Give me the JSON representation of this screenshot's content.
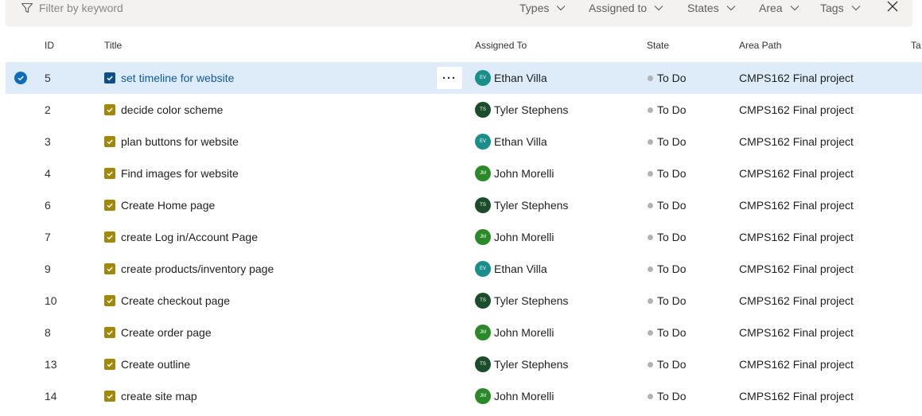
{
  "filter": {
    "placeholder": "Filter by keyword",
    "pills": [
      "Types",
      "Assigned to",
      "States",
      "Area",
      "Tags"
    ]
  },
  "columns": {
    "id": "ID",
    "title": "Title",
    "assigned": "Assigned To",
    "state": "State",
    "area": "Area Path",
    "tags": "Ta"
  },
  "colors": {
    "ethan": "#1a8f8a",
    "tyler": "#1b4d2b",
    "john": "#2a8a2a",
    "task_icon": "#a4880a",
    "selected_bg": "#deecf9",
    "accent": "#0f6cbd"
  },
  "rows": [
    {
      "id": "5",
      "title": "set timeline for website",
      "initials": "EV",
      "assigned": "Ethan Villa",
      "state": "To Do",
      "area": "CMPS162 Final project"
    },
    {
      "id": "2",
      "title": "decide color scheme",
      "initials": "TS",
      "assigned": "Tyler Stephens",
      "state": "To Do",
      "area": "CMPS162 Final project"
    },
    {
      "id": "3",
      "title": "plan buttons for website",
      "initials": "EV",
      "assigned": "Ethan Villa",
      "state": "To Do",
      "area": "CMPS162 Final project"
    },
    {
      "id": "4",
      "title": "Find images for website",
      "initials": "JM",
      "assigned": "John Morelli",
      "state": "To Do",
      "area": "CMPS162 Final project"
    },
    {
      "id": "6",
      "title": "Create Home page",
      "initials": "TS",
      "assigned": "Tyler Stephens",
      "state": "To Do",
      "area": "CMPS162 Final project"
    },
    {
      "id": "7",
      "title": "create Log in/Account Page",
      "initials": "JM",
      "assigned": "John Morelli",
      "state": "To Do",
      "area": "CMPS162 Final project"
    },
    {
      "id": "9",
      "title": "create products/inventory page",
      "initials": "EV",
      "assigned": "Ethan Villa",
      "state": "To Do",
      "area": "CMPS162 Final project"
    },
    {
      "id": "10",
      "title": "Create checkout page",
      "initials": "TS",
      "assigned": "Tyler Stephens",
      "state": "To Do",
      "area": "CMPS162 Final project"
    },
    {
      "id": "8",
      "title": "Create order page",
      "initials": "JM",
      "assigned": "John Morelli",
      "state": "To Do",
      "area": "CMPS162 Final project"
    },
    {
      "id": "13",
      "title": "Create outline",
      "initials": "TS",
      "assigned": "Tyler Stephens",
      "state": "To Do",
      "area": "CMPS162 Final project"
    },
    {
      "id": "14",
      "title": "create site map",
      "initials": "JM",
      "assigned": "John Morelli",
      "state": "To Do",
      "area": "CMPS162 Final project"
    }
  ]
}
